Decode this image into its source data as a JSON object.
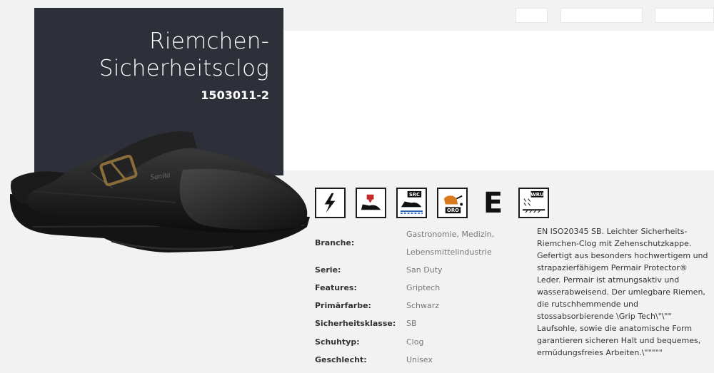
{
  "product": {
    "title_line1": "Riemchen-",
    "title_line2": "Sicherheitsclog",
    "sku": "1503011-2",
    "brand_mark": "Sanita"
  },
  "icons": [
    {
      "name": "electrical-hazard-icon"
    },
    {
      "name": "toe-cap-icon"
    },
    {
      "name": "src-slip-resistance-icon",
      "label": "SRC"
    },
    {
      "name": "oro-oil-resistance-icon",
      "label": "ORO"
    },
    {
      "name": "energy-absorption-e-icon",
      "label": "E"
    },
    {
      "name": "wru-water-resistance-icon",
      "label": "WRU"
    }
  ],
  "specs": [
    {
      "key": "Branche:",
      "value": "Gastronomie, Medizin, Lebensmittelindustrie"
    },
    {
      "key": "Serie:",
      "value": "San Duty"
    },
    {
      "key": "Features:",
      "value": "Griptech"
    },
    {
      "key": "Primärfarbe:",
      "value": "Schwarz"
    },
    {
      "key": "Sicherheitsklasse:",
      "value": "SB"
    },
    {
      "key": "Schuhtyp:",
      "value": "Clog"
    },
    {
      "key": "Geschlecht:",
      "value": "Unisex"
    }
  ],
  "description": "EN ISO20345 SB. Leichter Sicherheits-Riemchen-Clog mit Zehenschutzkappe. Gefertigt aus besonders hochwertigem und strapazierfähigem Permair Protector® Leder. Permair ist atmungsaktiv und wasserabweisend. Der umlegbare Riemen, die rutschhemmende und stossabsorbierende \\Grip Tech\\\"\\\"\" Laufsohle, sowie die anatomische Form garantieren sicheren Halt und bequemes, ermüdungsfreies Arbeiten.\\\"\"\"\"\"",
  "colors": {
    "panel": "#2d3039",
    "background": "#f2f2f2",
    "text": "#333333",
    "muted": "#777777"
  }
}
